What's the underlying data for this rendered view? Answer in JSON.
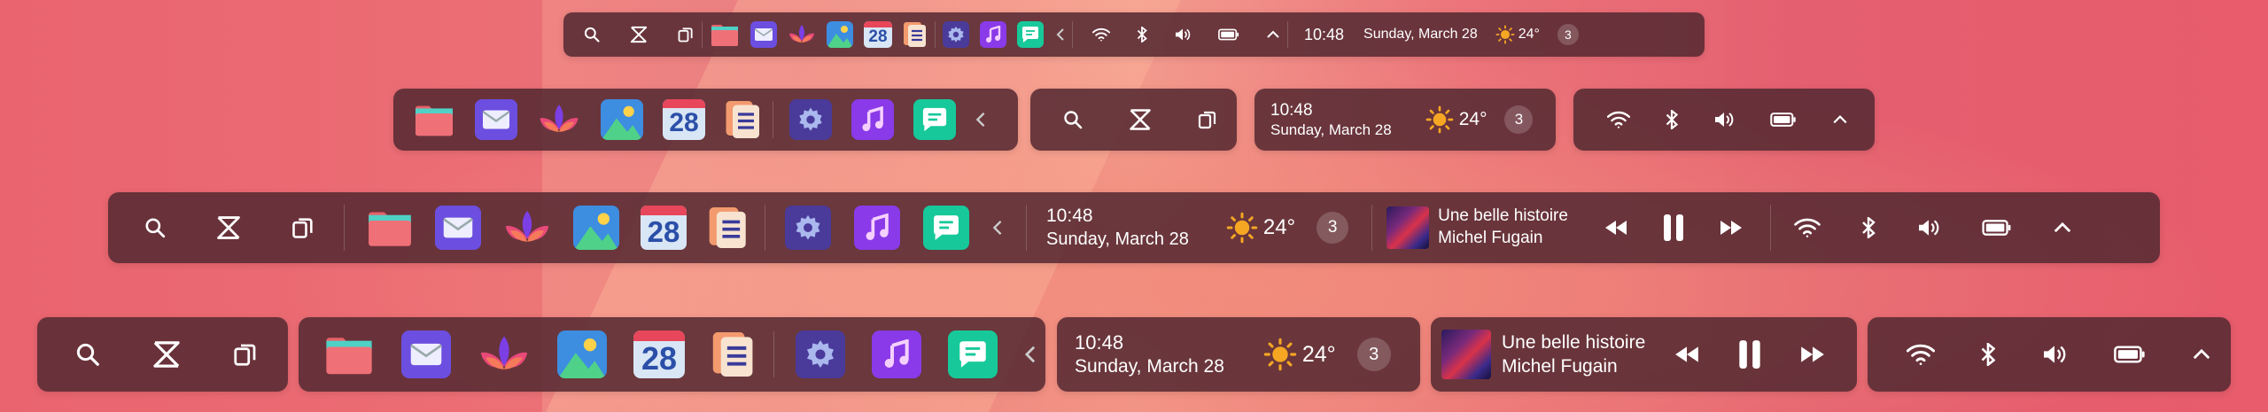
{
  "clock": {
    "time": "10:48",
    "date": "Sunday, March 28"
  },
  "weather": {
    "temp": "24°",
    "icon": "sun-icon"
  },
  "notifications": {
    "count": "3"
  },
  "calendar_day": "28",
  "media": {
    "title": "Une belle histoire",
    "artist": "Michel Fugain"
  },
  "apps": [
    "folder-icon",
    "mail-icon",
    "lotus-icon",
    "photos-icon",
    "calendar-icon",
    "notes-icon",
    "settings-icon",
    "music-icon",
    "messages-icon"
  ],
  "colors": {
    "bar": "#562a32",
    "accent": "#f5a623",
    "wallpaper": "#e9646f"
  }
}
